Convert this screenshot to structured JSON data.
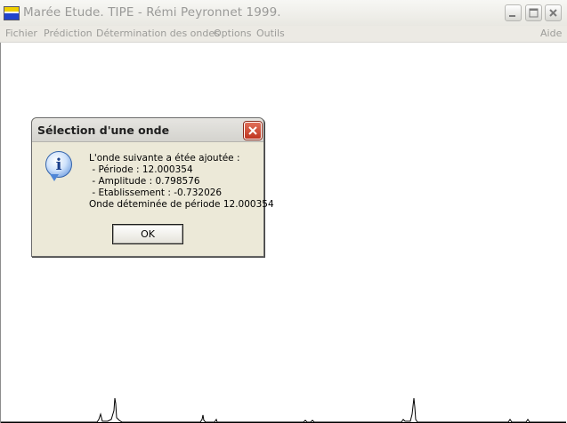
{
  "window": {
    "title": "Marée Etude. TIPE - Rémi Peyronnet 1999."
  },
  "menu": {
    "items": [
      "Fichier",
      "Prédiction",
      "Détermination des ondes",
      "Options",
      "Outils"
    ],
    "help": "Aide"
  },
  "dialog": {
    "title": "Sélection d'une onde",
    "icon": "information-icon",
    "lines": [
      "L'onde suivante a étée ajoutée :",
      " - Période : 12.000354",
      " - Amplitude : 0.798576",
      " - Etablissement : -0.732026",
      "Onde déteminée de période 12.000354"
    ],
    "ok_label": "OK"
  },
  "colors": {
    "dialog_bg": "#ece9d8",
    "close_button": "#c94a33",
    "plot_line": "#000000"
  }
}
